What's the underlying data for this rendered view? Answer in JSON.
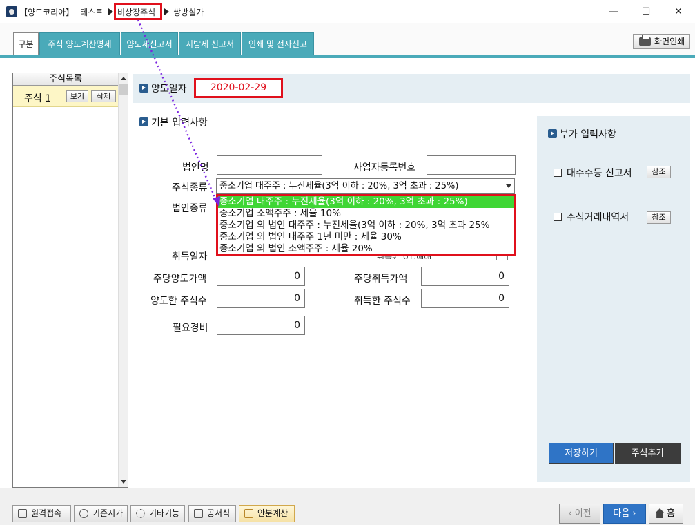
{
  "titlebar": {
    "app": "【양도코리아】",
    "crumbs": [
      "테스트",
      "비상장주식",
      "쌍방실가"
    ],
    "min": "—",
    "max": "☐",
    "close": "✕"
  },
  "tabs": [
    "구분",
    "주식 양도계산명세",
    "양도세신고서",
    "지방세 신고서",
    "인쇄 및 전자신고"
  ],
  "print_label": "화면인쇄",
  "stocklist": {
    "header": "주식목록",
    "item": "주식 1",
    "view": "보기",
    "delete": "삭제"
  },
  "sale_date": {
    "label": "양도일자",
    "value": "2020-02-29"
  },
  "basic_section": "기본 입력사항",
  "form": {
    "corp_name": "법인명",
    "biz_reg_no": "사업자등록번호",
    "stock_type": "주식종류",
    "stock_type_value": "중소기업 대주주 : 누진세율(3억 이하 : 20%, 3억 초과 : 25%)",
    "corp_type": "법인종류",
    "acq_date": "취득일자",
    "acq_type_partial": "취득유형",
    "acq_type_value_partial": "01.매매",
    "per_share_sale": "주당양도가액",
    "per_share_sale_value": "0",
    "per_share_acq": "주당취득가액",
    "per_share_acq_value": "0",
    "shares_sold": "양도한 주식수",
    "shares_sold_value": "0",
    "shares_acq": "취득한 주식수",
    "shares_acq_value": "0",
    "expenses": "필요경비",
    "expenses_value": "0"
  },
  "dropdown_options": [
    "중소기업 대주주 : 누진세율(3억 이하 : 20%, 3억 초과 : 25%)",
    "중소기업 소액주주 : 세율 10%",
    "중소기업 외 법인 대주주 : 누진세율(3억 이하 : 20%, 3억 초과 25%",
    "중소기업 외 법인 대주주 1년 미만 : 세율 30%",
    "중소기업 외 법인 소액주주 : 세율 20%"
  ],
  "extra": {
    "title": "부가 입력사항",
    "major_report": "대주주등 신고서",
    "trade_details": "주식거래내역서",
    "ref": "참조",
    "save": "저장하기",
    "add": "주식추가"
  },
  "bottom": {
    "remote": "원격접속",
    "base_price": "기준시가",
    "other": "기타기능",
    "notice": "공서식",
    "split": "안분계산",
    "prev": "‹ 이전",
    "next": "다음 ›",
    "home": "홈"
  },
  "colors": {
    "tab_bg": "#4aaab9",
    "highlight_red": "#e0101c",
    "selected_option": "#3fd635",
    "primary_button": "#2f74c6",
    "dark_button": "#3c3c3c"
  }
}
